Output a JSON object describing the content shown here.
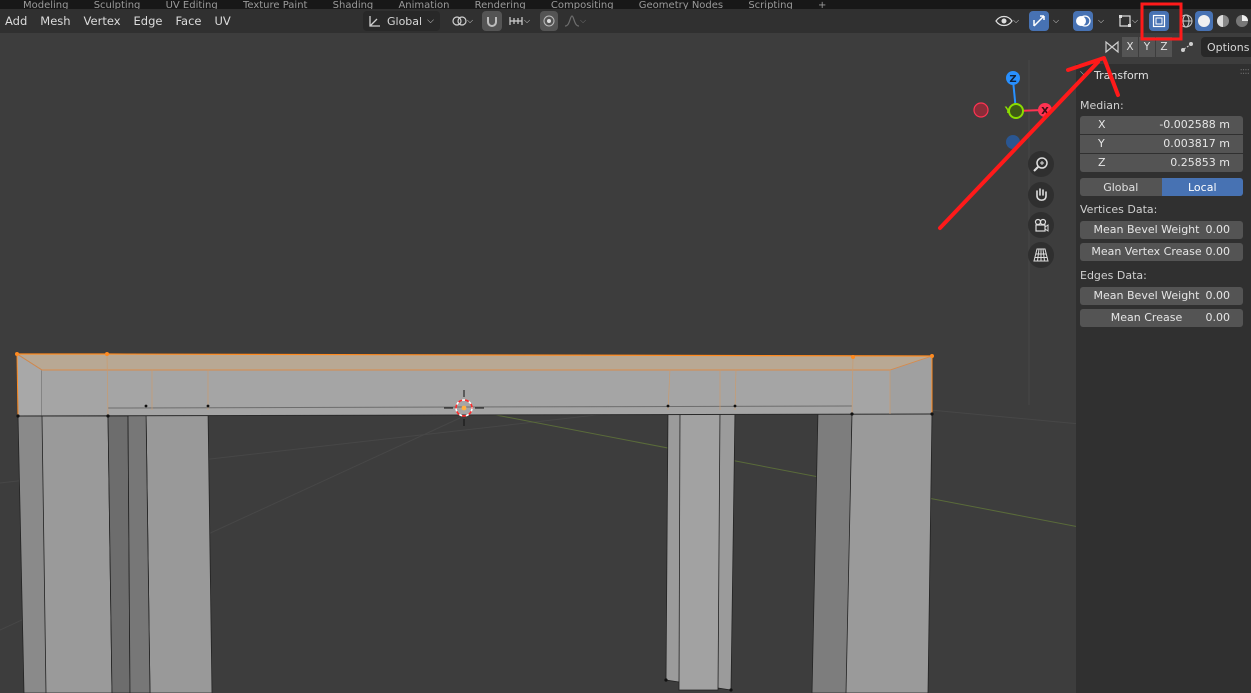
{
  "workspace_tabs": [
    "Modeling",
    "Sculpting",
    "UV Editing",
    "Texture Paint",
    "Shading",
    "Animation",
    "Rendering",
    "Compositing",
    "Geometry Nodes",
    "Scripting",
    "+"
  ],
  "menu": {
    "items": [
      "Add",
      "Mesh",
      "Vertex",
      "Edge",
      "Face",
      "UV"
    ]
  },
  "header": {
    "orientation": "Global"
  },
  "axes_toggle": [
    "X",
    "Y",
    "Z"
  ],
  "options_label": "Options",
  "gizmo": {
    "z": "Z",
    "y": "Y",
    "x": "X"
  },
  "panel": {
    "title": "Transform",
    "median_label": "Median:",
    "median": [
      {
        "axis": "X",
        "value": "-0.002588 m"
      },
      {
        "axis": "Y",
        "value": "0.003817 m"
      },
      {
        "axis": "Z",
        "value": "0.25853 m"
      }
    ],
    "space": {
      "global": "Global",
      "local": "Local",
      "active": "Local"
    },
    "vertices_label": "Vertices Data:",
    "vertices": [
      {
        "label": "Mean Bevel Weight",
        "value": "0.00"
      },
      {
        "label": "Mean Vertex Crease",
        "value": "0.00"
      }
    ],
    "edges_label": "Edges Data:",
    "edges": [
      {
        "label": "Mean Bevel Weight",
        "value": "0.00"
      },
      {
        "label": "Mean Crease",
        "value": "0.00"
      }
    ]
  },
  "colors": {
    "viewport_bg": "#3d3d3d",
    "header_bg": "#303030",
    "accent_blue": "#4772b3",
    "selection_orange": "#ff8a1f",
    "annotation_red": "#ff1a1a",
    "gizmo_x": "#ff3352",
    "gizmo_y": "#8bdc00",
    "gizmo_z": "#2890ff"
  }
}
